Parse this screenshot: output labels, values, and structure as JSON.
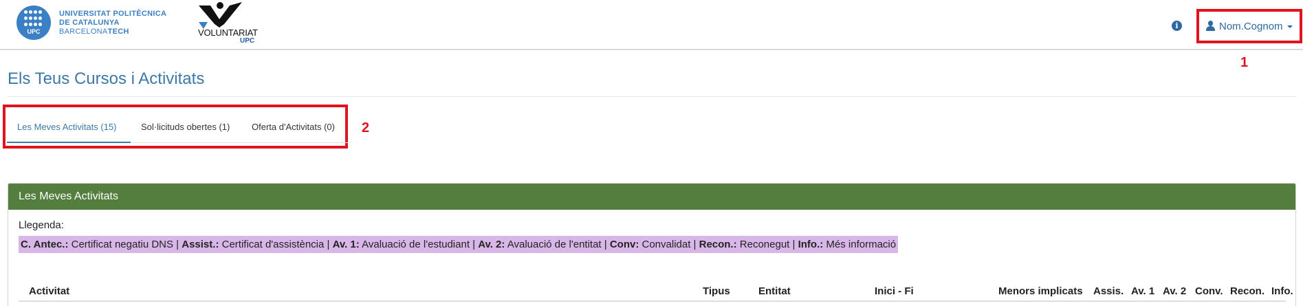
{
  "header": {
    "university": {
      "line1": "UNIVERSITAT POLITÈCNICA",
      "line2": "DE CATALUNYA",
      "line3_regular": "BARCELONA",
      "line3_bold": "TECH",
      "mark": "UPC"
    },
    "volunteer_logo": {
      "word": "VOLUNTARIAT",
      "sub": "UPC"
    },
    "info_icon": "info-circle-icon",
    "user": {
      "name": "Nom.Cognom",
      "icon": "user-icon",
      "caret": "caret-down-icon"
    }
  },
  "annotations": {
    "one": "1",
    "two": "2"
  },
  "page": {
    "title": "Els Teus Cursos i Activitats"
  },
  "tabs": [
    {
      "label": "Les Meves Activitats (15)",
      "active": true
    },
    {
      "label": "Sol·licituds obertes (1)",
      "active": false
    },
    {
      "label": "Oferta d'Activitats (0)",
      "active": false
    }
  ],
  "panel": {
    "title": "Les Meves Activitats",
    "legend_label": "Llegenda:",
    "legend": [
      {
        "key": "C. Antec.:",
        "value": " Certificat negatiu DNS | "
      },
      {
        "key": "Assist.:",
        "value": " Certificat d'assistència | "
      },
      {
        "key": "Av. 1:",
        "value": " Avaluació de l'estudiant | "
      },
      {
        "key": "Av. 2:",
        "value": " Avaluació de l'entitat | "
      },
      {
        "key": "Conv:",
        "value": " Convalidat | "
      },
      {
        "key": "Recon.:",
        "value": " Reconegut | "
      },
      {
        "key": "Info.:",
        "value": " Més informació"
      }
    ],
    "columns": [
      "Activitat",
      "Tipus",
      "Entitat",
      "Inici - Fi",
      "Menors implicats",
      "Assis.",
      "Av. 1",
      "Av. 2",
      "Conv.",
      "Recon.",
      "Info."
    ]
  },
  "colors": {
    "primary": "#3c79a6",
    "panel_header": "#537e3e",
    "legend_bg": "#d8b7e8",
    "annotation": "#e0141e",
    "upc_blue": "#3b7fc4"
  }
}
